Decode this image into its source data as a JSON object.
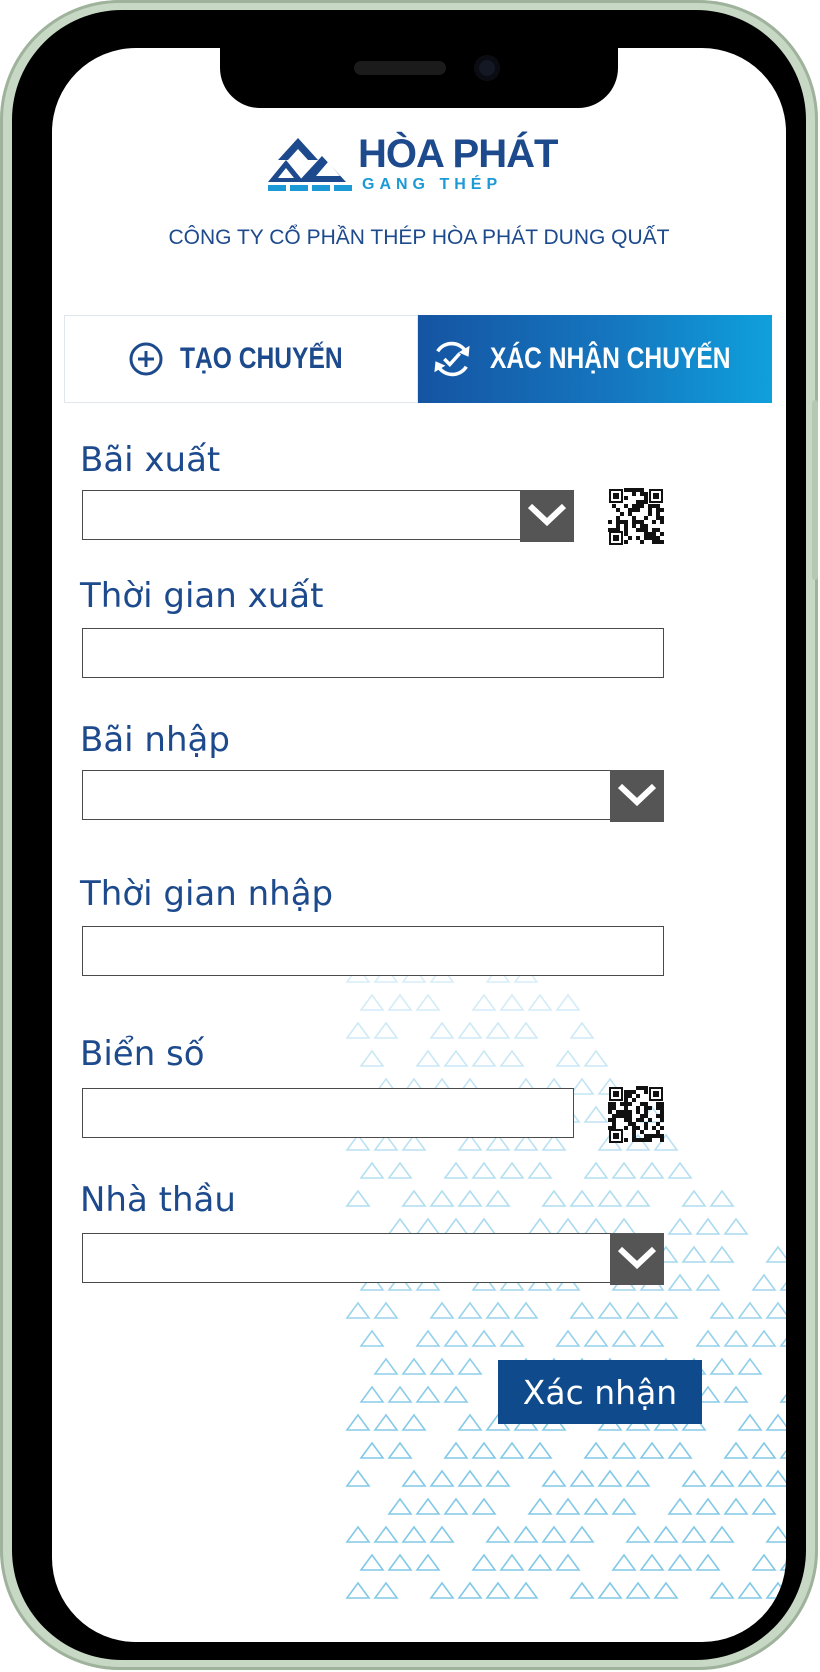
{
  "header": {
    "brand": "HÒA PHÁT",
    "brand_sub": "GANG THÉP",
    "company": "CÔNG TY CỔ PHẦN THÉP HÒA PHÁT DUNG QUẤT"
  },
  "tabs": [
    {
      "label": "TẠO CHUYẾN",
      "icon": "plus-circle-icon",
      "active": false
    },
    {
      "label": "XÁC NHẬN CHUYẾN",
      "icon": "refresh-check-icon",
      "active": true
    }
  ],
  "form": {
    "export_yard": {
      "label": "Bãi xuất",
      "value": ""
    },
    "export_time": {
      "label": "Thời gian xuất",
      "value": ""
    },
    "import_yard": {
      "label": "Bãi nhập",
      "value": ""
    },
    "import_time": {
      "label": "Thời gian nhập",
      "value": ""
    },
    "plate": {
      "label": "Biển số",
      "value": ""
    },
    "contractor": {
      "label": "Nhà thầu",
      "value": ""
    },
    "submit_label": "Xác nhận"
  },
  "colors": {
    "primary": "#1d4a8d",
    "accent": "#1c9ad6",
    "button": "#0f4a8c",
    "dropdown": "#555555"
  }
}
